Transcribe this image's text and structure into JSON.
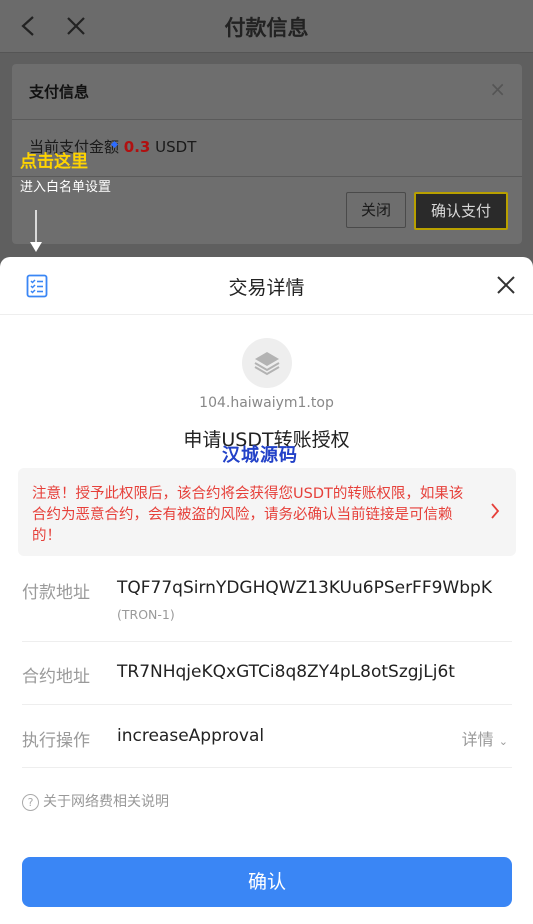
{
  "background": {
    "header_title": "付款信息",
    "dialog": {
      "title": "支付信息",
      "close_symbol": "×",
      "amount_label": "当前支付金额",
      "amount_value": "0.3",
      "amount_unit": "USDT",
      "close_button": "关闭",
      "confirm_button": "确认支付"
    },
    "hint": {
      "main": "点击这里",
      "sub": "进入白名单设置",
      "color": "#ffd400"
    }
  },
  "sheet": {
    "title": "交易详情",
    "dapp_url": "104.haiwaiym1.top",
    "action": "申请USDT转账授权",
    "watermark": "汉城源码",
    "warning": "注意！授予此权限后，该合约将会获得您USDT的转账权限，如果该合约为恶意合约，会有被盗的风险，请务必确认当前链接是可信赖的！",
    "warning_color": "#e6403a",
    "rows": [
      {
        "label": "付款地址",
        "value": "TQF77qSirnYDGHQWZ13KUu6PSerFF9WbpK",
        "sub": "(TRON-1)"
      },
      {
        "label": "合约地址",
        "value": "TR7NHqjeKQxGTCi8q8ZY4pL8otSzgjLj6t"
      },
      {
        "label": "执行操作",
        "value": "increaseApproval",
        "detail": "详情"
      }
    ],
    "fee_note": "关于网络费相关说明",
    "confirm_button": "确认",
    "accent_color": "#3a86f5"
  }
}
